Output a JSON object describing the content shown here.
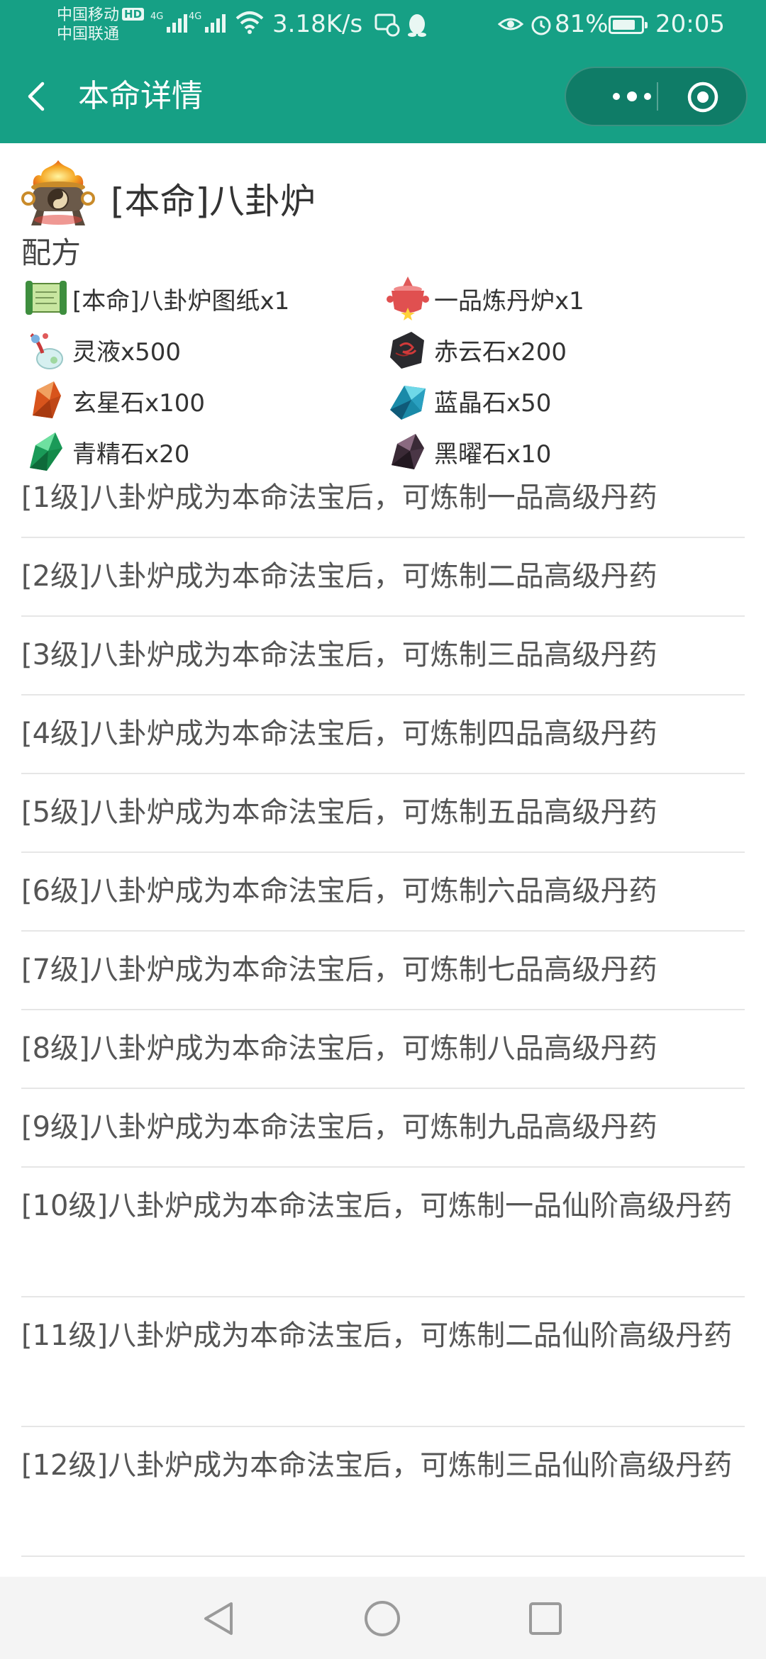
{
  "status_bar": {
    "carrier_1": "中国移动",
    "carrier_1_badge": "HD",
    "carrier_2": "中国联通",
    "net_1": "4G",
    "net_2": "4G",
    "speed": "3.18K/s",
    "battery_pct": "81%",
    "battery_level": 0.81,
    "time": "20:05",
    "icons": [
      "hd-badge-icon",
      "signal-icon",
      "signal-icon",
      "wifi-icon",
      "message-icon",
      "qq-penguin-icon",
      "eye-icon",
      "alarm-icon",
      "battery-icon"
    ]
  },
  "nav": {
    "title": "本命详情",
    "icons": [
      "back-arrow-icon",
      "more-dots-icon",
      "close-target-icon"
    ],
    "colors": {
      "bar": "#16a085",
      "capsule": "#0f7c67"
    }
  },
  "item": {
    "title": "[本命]八卦炉",
    "icon": "bagua-furnace-icon"
  },
  "recipe": {
    "label": "配方",
    "ingredients": [
      {
        "name": "[本命]八卦炉图纸x1",
        "icon": "scroll-icon"
      },
      {
        "name": "一品炼丹炉x1",
        "icon": "red-furnace-icon"
      },
      {
        "name": "灵液x500",
        "icon": "spirit-liquid-icon"
      },
      {
        "name": "赤云石x200",
        "icon": "red-cloud-stone-icon"
      },
      {
        "name": "玄星石x100",
        "icon": "orange-crystal-icon"
      },
      {
        "name": "蓝晶石x50",
        "icon": "blue-crystal-icon"
      },
      {
        "name": "青精石x20",
        "icon": "green-crystal-icon"
      },
      {
        "name": "黑曜石x10",
        "icon": "obsidian-icon"
      }
    ]
  },
  "levels": [
    "[1级]八卦炉成为本命法宝后，可炼制一品高级丹药",
    "[2级]八卦炉成为本命法宝后，可炼制二品高级丹药",
    "[3级]八卦炉成为本命法宝后，可炼制三品高级丹药",
    "[4级]八卦炉成为本命法宝后，可炼制四品高级丹药",
    "[5级]八卦炉成为本命法宝后，可炼制五品高级丹药",
    "[6级]八卦炉成为本命法宝后，可炼制六品高级丹药",
    "[7级]八卦炉成为本命法宝后，可炼制七品高级丹药",
    "[8级]八卦炉成为本命法宝后，可炼制八品高级丹药",
    "[9级]八卦炉成为本命法宝后，可炼制九品高级丹药",
    "[10级]八卦炉成为本命法宝后，可炼制一品仙阶高级丹药",
    "[11级]八卦炉成为本命法宝后，可炼制二品仙阶高级丹药",
    "[12级]八卦炉成为本命法宝后，可炼制三品仙阶高级丹药"
  ],
  "system_nav": {
    "icons": [
      "back-triangle-icon",
      "home-circle-icon",
      "recents-square-icon"
    ]
  }
}
